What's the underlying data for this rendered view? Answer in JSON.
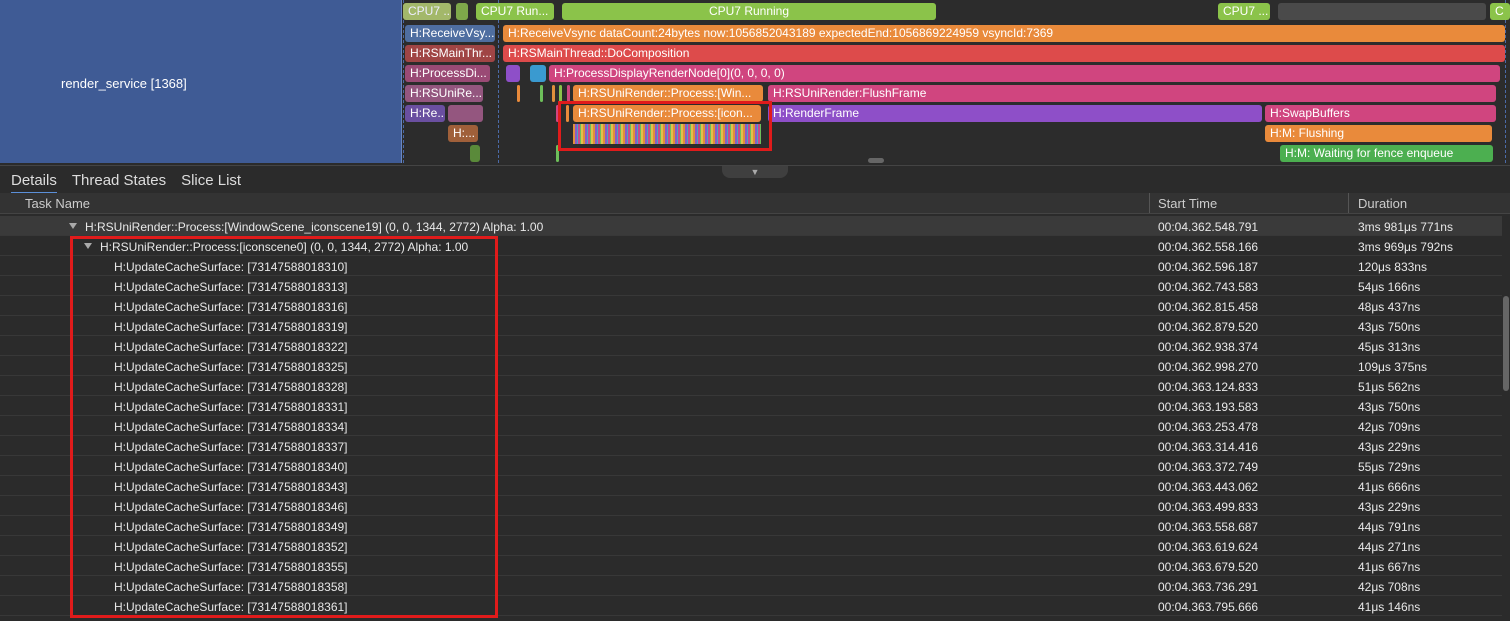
{
  "process_label": "render_service [1368]",
  "cpu_slices": [
    "CPU7 ...",
    "CPU7 Run...",
    "CPU7 Running",
    "CPU7 ...",
    "C"
  ],
  "thread_labels": [
    "H:ReceiveVsy...",
    "H:RSMainThr...",
    "H:ProcessDi...",
    "H:RSUniRe...",
    "H:Re...",
    "H:..."
  ],
  "trace_slices": {
    "receive_vsync": "H:ReceiveVsync dataCount:24bytes now:1056852043189 expectedEnd:1056869224959 vsyncId:7369",
    "do_composition": "H:RSMainThread::DoComposition",
    "process_display": "H:ProcessDisplayRenderNode[0](0, 0, 0, 0)",
    "process_window": "H:RSUniRender::Process:[Win...",
    "flush_frame": "H:RSUniRender:FlushFrame",
    "process_icon": "H:RSUniRender::Process:[icon...",
    "render_frame": "H:RenderFrame",
    "swap_buffers": "H:SwapBuffers",
    "flushing": "H:M: Flushing",
    "waiting_fence": "H:M: Waiting for fence enqueue"
  },
  "tabs": [
    "Details",
    "Thread States",
    "Slice List"
  ],
  "columns": {
    "task": "Task Name",
    "start": "Start Time",
    "duration": "Duration"
  },
  "rows": [
    {
      "name": "H:RSUniRender::Process:[WindowScene_iconscene19] (0, 0, 1344, 2772) Alpha: 1.00",
      "start": "00:04.362.548.791",
      "duration": "3ms 981μs 771ns"
    },
    {
      "name": "H:RSUniRender::Process:[iconscene0] (0, 0, 1344, 2772) Alpha: 1.00",
      "start": "00:04.362.558.166",
      "duration": "3ms 969μs 792ns"
    },
    {
      "name": "H:UpdateCacheSurface: [73147588018310]",
      "start": "00:04.362.596.187",
      "duration": "120μs 833ns"
    },
    {
      "name": "H:UpdateCacheSurface: [73147588018313]",
      "start": "00:04.362.743.583",
      "duration": "54μs 166ns"
    },
    {
      "name": "H:UpdateCacheSurface: [73147588018316]",
      "start": "00:04.362.815.458",
      "duration": "48μs 437ns"
    },
    {
      "name": "H:UpdateCacheSurface: [73147588018319]",
      "start": "00:04.362.879.520",
      "duration": "43μs 750ns"
    },
    {
      "name": "H:UpdateCacheSurface: [73147588018322]",
      "start": "00:04.362.938.374",
      "duration": "45μs 313ns"
    },
    {
      "name": "H:UpdateCacheSurface: [73147588018325]",
      "start": "00:04.362.998.270",
      "duration": "109μs 375ns"
    },
    {
      "name": "H:UpdateCacheSurface: [73147588018328]",
      "start": "00:04.363.124.833",
      "duration": "51μs 562ns"
    },
    {
      "name": "H:UpdateCacheSurface: [73147588018331]",
      "start": "00:04.363.193.583",
      "duration": "43μs 750ns"
    },
    {
      "name": "H:UpdateCacheSurface: [73147588018334]",
      "start": "00:04.363.253.478",
      "duration": "42μs 709ns"
    },
    {
      "name": "H:UpdateCacheSurface: [73147588018337]",
      "start": "00:04.363.314.416",
      "duration": "43μs 229ns"
    },
    {
      "name": "H:UpdateCacheSurface: [73147588018340]",
      "start": "00:04.363.372.749",
      "duration": "55μs 729ns"
    },
    {
      "name": "H:UpdateCacheSurface: [73147588018343]",
      "start": "00:04.363.443.062",
      "duration": "41μs 666ns"
    },
    {
      "name": "H:UpdateCacheSurface: [73147588018346]",
      "start": "00:04.363.499.833",
      "duration": "43μs 229ns"
    },
    {
      "name": "H:UpdateCacheSurface: [73147588018349]",
      "start": "00:04.363.558.687",
      "duration": "44μs 791ns"
    },
    {
      "name": "H:UpdateCacheSurface: [73147588018352]",
      "start": "00:04.363.619.624",
      "duration": "44μs 271ns"
    },
    {
      "name": "H:UpdateCacheSurface: [73147588018355]",
      "start": "00:04.363.679.520",
      "duration": "41μs 667ns"
    },
    {
      "name": "H:UpdateCacheSurface: [73147588018358]",
      "start": "00:04.363.736.291",
      "duration": "42μs 708ns"
    },
    {
      "name": "H:UpdateCacheSurface: [73147588018361]",
      "start": "00:04.363.795.666",
      "duration": "41μs 146ns"
    }
  ],
  "colors": {
    "highlight": "#e01b1b",
    "process_bg": "#3f5b95",
    "cpu_green": "#8bc34a",
    "orange": "#e98a3b",
    "red": "#dd4b4b",
    "pink": "#d0457f",
    "purple": "#8e4fc8"
  }
}
